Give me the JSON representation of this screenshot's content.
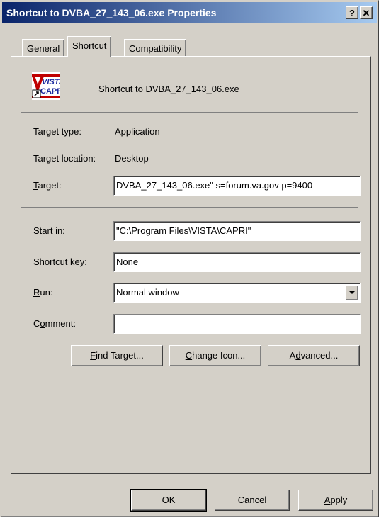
{
  "window": {
    "title": "Shortcut to DVBA_27_143_06.exe Properties",
    "help_label": "?",
    "close_label": "✕"
  },
  "tabs": [
    {
      "label": "General",
      "active": false
    },
    {
      "label": "Shortcut",
      "active": true
    },
    {
      "label": "Compatibility",
      "active": false
    }
  ],
  "header": {
    "name": "Shortcut to DVBA_27_143_06.exe",
    "icon": "vista-capri-app-icon",
    "icon_text_top": "VISTA",
    "icon_text_bottom": "CAPRI"
  },
  "info": {
    "target_type_label": "Target type:",
    "target_type_value": "Application",
    "target_location_label": "Target location:",
    "target_location_value": "Desktop"
  },
  "fields": {
    "target": {
      "label_mnemonic": "T",
      "label_rest": "arget:",
      "value": "DVBA_27_143_06.exe\" s=forum.va.gov p=9400"
    },
    "start_in": {
      "label_mnemonic": "S",
      "label_rest": "tart in:",
      "value": "\"C:\\Program Files\\VISTA\\CAPRI\""
    },
    "shortcut_key": {
      "label_pre": "Shortcut ",
      "label_mnemonic": "k",
      "label_rest": "ey:",
      "value": "None"
    },
    "run": {
      "label_mnemonic": "R",
      "label_rest": "un:",
      "value": "Normal window"
    },
    "comment": {
      "label_pre": "C",
      "label_mnemonic": "o",
      "label_rest": "mment:",
      "value": ""
    }
  },
  "actions": {
    "find_target": {
      "mnemonic": "F",
      "rest": "ind Target..."
    },
    "change_icon": {
      "mnemonic": "C",
      "rest": "hange Icon..."
    },
    "advanced": {
      "pre": "A",
      "mnemonic": "d",
      "rest": "vanced..."
    }
  },
  "footer": {
    "ok": "OK",
    "cancel": "Cancel",
    "apply_mnemonic": "A",
    "apply_rest": "pply"
  },
  "colors": {
    "title_gradient_start": "#0a246a",
    "title_gradient_end": "#a6caf0",
    "face": "#d4d0c8"
  }
}
